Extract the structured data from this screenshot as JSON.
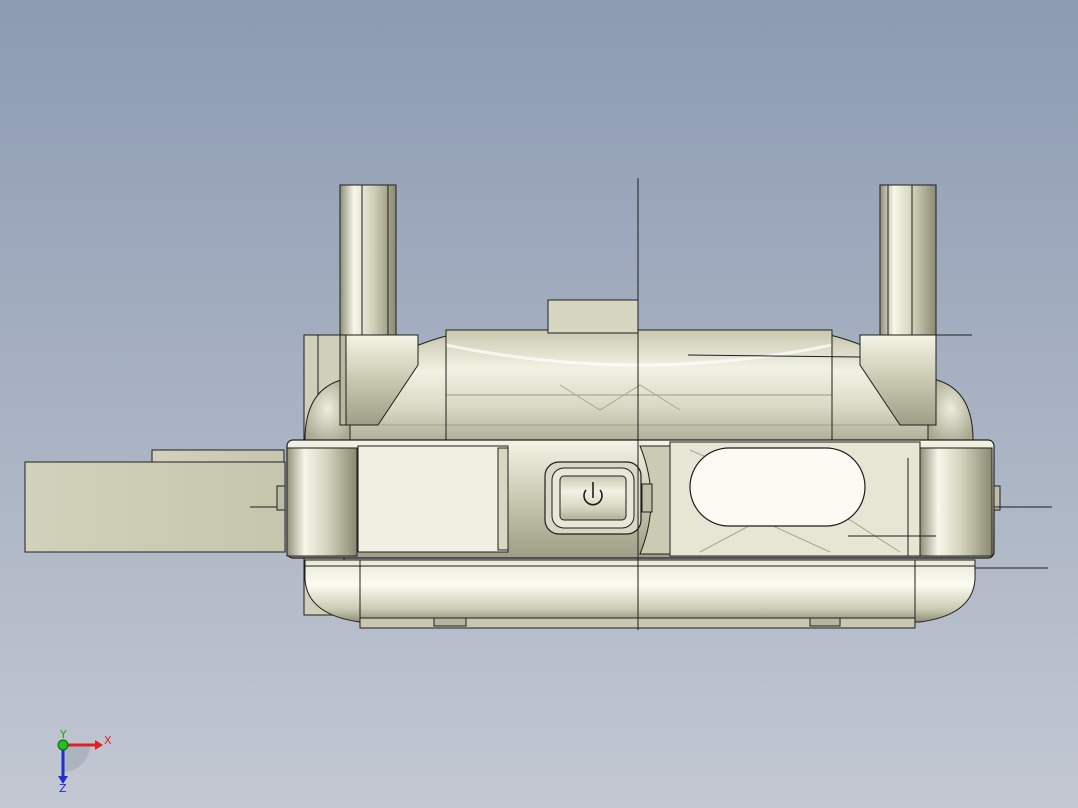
{
  "viewport": {
    "background_top": "#8c9bb2",
    "background_bottom": "#c3c8d2",
    "model": {
      "body_color": "#d3d3bd",
      "edge_color": "#1e1e1e"
    }
  },
  "triad": {
    "x_label": "X",
    "y_label": "Y",
    "z_label": "Z",
    "x_color": "#e02020",
    "y_color": "#20c020",
    "z_color": "#2030d0"
  },
  "icons": {
    "power": "power-icon"
  }
}
